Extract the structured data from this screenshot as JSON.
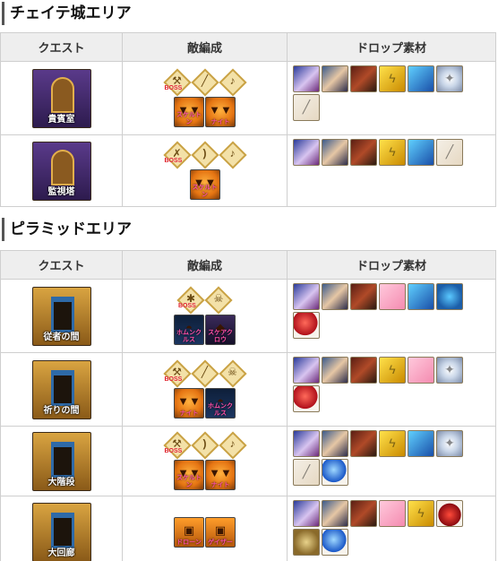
{
  "sections": [
    {
      "title": "チェイテ城エリア",
      "headers": [
        "クエスト",
        "敵編成",
        "ドロップ素材"
      ],
      "rows": [
        {
          "quest": {
            "label": "貴賓室",
            "theme": "castle"
          },
          "enemies": {
            "top": [
              {
                "icon": "hammer-icon",
                "boss": "BOSS"
              },
              {
                "icon": "wand-icon"
              },
              {
                "icon": "horn-icon"
              }
            ],
            "bottom": [
              {
                "kind": "pumpkin",
                "label": "スケルトン"
              },
              {
                "kind": "pumpkin",
                "label": "ナイト"
              }
            ]
          },
          "drops": [
            "mage-card",
            "duo-card",
            "beast-card",
            "lightning-item",
            "cone-item",
            "gem-item",
            "staff-item"
          ]
        },
        {
          "quest": {
            "label": "監視塔",
            "theme": "castle"
          },
          "enemies": {
            "top": [
              {
                "icon": "sword-icon",
                "boss": "BOSS"
              },
              {
                "icon": "bow-icon"
              },
              {
                "icon": "horn-icon"
              }
            ],
            "bottom": [
              {
                "kind": "pumpkin",
                "label": "スケルトン"
              }
            ]
          },
          "drops": [
            "mage-card",
            "duo-card",
            "beast-card",
            "lightning-item",
            "cone-item",
            "staff-item"
          ]
        }
      ]
    },
    {
      "title": "ピラミッドエリア",
      "headers": [
        "クエスト",
        "敵編成",
        "ドロップ素材"
      ],
      "rows": [
        {
          "quest": {
            "label": "従者の間",
            "theme": "pyramid"
          },
          "enemies": {
            "top": [
              {
                "icon": "crab-icon",
                "boss": "BOSS"
              },
              {
                "icon": "skull-icon"
              }
            ],
            "bottom": [
              {
                "kind": "ghost",
                "label": "ホムンクルス"
              },
              {
                "kind": "dark",
                "label": "スケアクロウ"
              }
            ]
          },
          "drops": [
            "mage-card",
            "duo-card",
            "beast-card",
            "pink-item",
            "cone-item",
            "lantern-item",
            "red-orb"
          ]
        },
        {
          "quest": {
            "label": "祈りの間",
            "theme": "pyramid"
          },
          "enemies": {
            "top": [
              {
                "icon": "hammer-icon",
                "boss": "BOSS"
              },
              {
                "icon": "wand-icon"
              },
              {
                "icon": "skull-icon"
              }
            ],
            "bottom": [
              {
                "kind": "pumpkin",
                "label": "ナイト"
              },
              {
                "kind": "ghost",
                "label": "ホムンクルス"
              }
            ]
          },
          "drops": [
            "mage-card",
            "duo-card",
            "beast-card",
            "lightning-item",
            "pink-item",
            "gem-item",
            "red-orb"
          ]
        },
        {
          "quest": {
            "label": "大階段",
            "theme": "pyramid"
          },
          "enemies": {
            "top": [
              {
                "icon": "hammer-icon",
                "boss": "BOSS"
              },
              {
                "icon": "bow-icon"
              },
              {
                "icon": "horn-icon"
              }
            ],
            "bottom": [
              {
                "kind": "pumpkin",
                "label": "スケルトン"
              },
              {
                "kind": "pumpkin",
                "label": "ナイト"
              }
            ]
          },
          "drops": [
            "mage-card",
            "duo-card",
            "beast-card",
            "lightning-item",
            "cone-item",
            "gem-item",
            "staff-item",
            "blue-orb"
          ]
        },
        {
          "quest": {
            "label": "大回廊",
            "theme": "pyramid"
          },
          "enemies": {
            "top": [],
            "bottom": [
              {
                "kind": "orange",
                "label": "ドローン"
              },
              {
                "kind": "orange",
                "label": "ゲイザー"
              }
            ]
          },
          "drops": [
            "mage-card",
            "duo-card",
            "beast-card",
            "pink-item",
            "lightning-item",
            "red-drop",
            "ring-item",
            "blue-orb"
          ]
        }
      ]
    }
  ]
}
